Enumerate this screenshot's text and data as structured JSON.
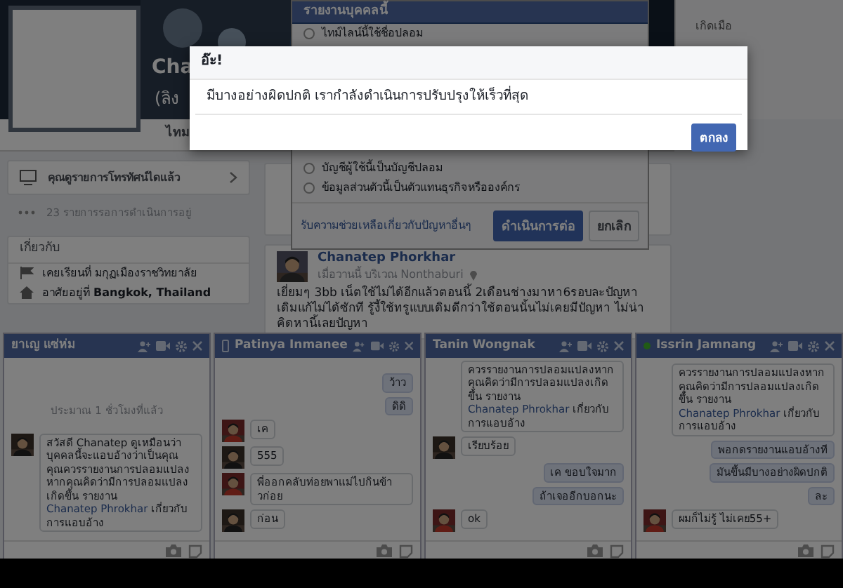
{
  "profile": {
    "name": "Cha",
    "subtitle": "(ลิง",
    "tab": "ไทม"
  },
  "side_info": "เกิดเมือ",
  "tv_card": {
    "title": "คุณดูรายการโทรทัศน์ไดแล้ว",
    "pending": "23 รายการรอการดำเนินการอยู่"
  },
  "about": {
    "title": "เกี่ยวกับ",
    "items": [
      {
        "kind": "school",
        "text": "เคยเรียนที่ มกุฏเมืองราชวิทยาลัย"
      },
      {
        "kind": "home",
        "text": "อาศัยอยู่ที่ **Bangkok, Thailand**"
      }
    ]
  },
  "post": {
    "author": "Chanatep Phorkhar",
    "meta": "เมื่อวานนี้ บริเวณ Nonthaburi",
    "text": "เยี่ยมๆ 3bb เน็ตใช้ไม่ได้อีกแล้วตอนนี้ 2เดือนช่างมาหา6รอบละปัญหาเดิมแก้ไม่ได้ซักที รู้งี้ใช้ทรูแบบเดิมดีกว่าใช้ตอนนั้นไม่เคยมีปัญหา ไม่น่าคิดหานี้เลยปัญหา"
  },
  "report_dialog": {
    "title": "รายงานบุคคลนี้",
    "options": [
      {
        "label": "ไทม์ไลน์นี้ใช้ชื่อปลอม",
        "selected": false
      },
      {
        "label": "บัญชีผู้ใช้นี้เป็นบัญชีปลอม",
        "selected": false
      },
      {
        "label": "ข้อมูลส่วนตัวนี้เป็นตัวแทนธุรกิจหรือองค์กร",
        "selected": false
      }
    ],
    "help_link": "รับความช่วยเหลือเกี่ยวกับปัญหาอื่นๆ",
    "buttons": [
      {
        "label": "ดำเนินการต่อ",
        "kind": "primary"
      },
      {
        "label": "ยกเลิก",
        "kind": "secondary"
      }
    ]
  },
  "error_dialog": {
    "title": "อ๊ะ!",
    "message": "มีบางอย่างผิดปกติ เรากำลังดำเนินการปรับปรุงให้เร็วที่สุด",
    "button": "ตกลง"
  },
  "chats": [
    {
      "name": "ยาเญ แซ่ห่ม",
      "mobile": false,
      "online": false,
      "messages": [
        {
          "kind": "time",
          "text": "ประมาณ 1 ชั่วโมงที่แล้ว"
        },
        {
          "kind": "theirs",
          "text": "สวัสดี Chanatep ดูเหมือนว่าบุคคลนี้จะแอบอ้างว่าเป็นคุณ คุณควรรายงานการปลอมแปลงหากคุณคิดว่ามีการปลอมแปลงเกิดขึ้น รายงาน ",
          "link": "Chanatep Phrokhar",
          "text_after": " เกี่ยวกับการแอบอ้าง"
        }
      ]
    },
    {
      "name": "Patinya Inmanee",
      "mobile": true,
      "online": false,
      "messages": [
        {
          "kind": "mine",
          "text": "ว้าว"
        },
        {
          "kind": "mine",
          "text": "ดิดิ"
        },
        {
          "kind": "theirs",
          "text": "เค"
        },
        {
          "kind": "theirs",
          "text": "555"
        },
        {
          "kind": "theirs",
          "text": "พี่ออกคลับท่อยพาแม่ไปกินข้าวก่อย"
        },
        {
          "kind": "theirs",
          "text": "ก่อน"
        }
      ]
    },
    {
      "name": "Tanin Wongnak",
      "mobile": false,
      "online": false,
      "messages": [
        {
          "kind": "notice",
          "text": "ควรรายงานการปลอมแปลงหากคุณคิดว่ามีการปลอมแปลงเกิดขึ้น รายงาน ",
          "link": "Chanatep Phrokhar",
          "text_after": " เกี่ยวกับการแอบอ้าง"
        },
        {
          "kind": "theirs",
          "text": "เรียบร้อย"
        },
        {
          "kind": "mine",
          "text": "เค ขอบใจมาก"
        },
        {
          "kind": "mine",
          "text": "ถ้าเจออีกบอกนะ"
        },
        {
          "kind": "theirs",
          "text": "ok"
        }
      ]
    },
    {
      "name": "Issrin Jamnang",
      "mobile": false,
      "online": true,
      "messages": [
        {
          "kind": "notice",
          "text": "ควรรายงานการปลอมแปลงหากคุณคิดว่ามีการปลอมแปลงเกิดขึ้น รายงาน ",
          "link": "Chanatep Phrokhar",
          "text_after": " เกี่ยวกับการแอบอ้าง"
        },
        {
          "kind": "mine",
          "text": "พอกดรายงานแอบอ้างที"
        },
        {
          "kind": "mine",
          "text": "มันขึ้นมีบางอย่างผิดปกติ"
        },
        {
          "kind": "mine",
          "text": "ละ"
        },
        {
          "kind": "theirs",
          "text": "ผมก็ไม่รู้ ไม่เคย55+"
        }
      ]
    }
  ]
}
